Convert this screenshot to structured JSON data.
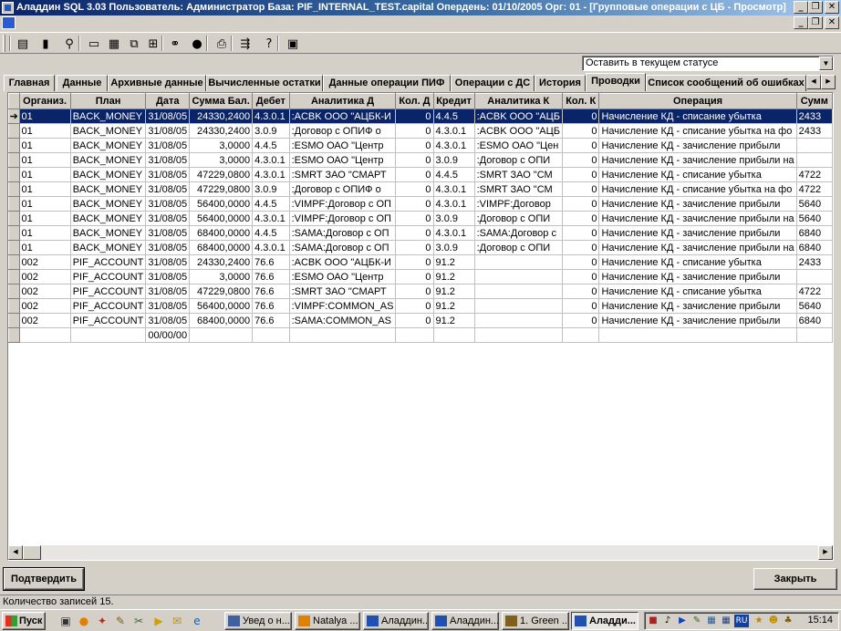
{
  "window": {
    "title": "Аладдин SQL 3.03 Пользователь: Администратор База: PIF_INTERNAL_TEST.capital Опердень: 01/10/2005 Орг: 01 - [Групповые операции с ЦБ - Просмотр]",
    "min_glyph": "_",
    "max_glyph": "❐",
    "close_glyph": "✕"
  },
  "toolbar": {
    "icons": [
      "doc-icon",
      "trash-icon",
      "tree-search-icon",
      "window-icon",
      "grid-icon",
      "cascade-icon",
      "split-icon",
      "binoculars-icon",
      "stop-icon",
      "print-icon",
      "export-icon",
      "help-icon",
      "exit-icon"
    ],
    "glyphs": [
      "▤",
      "▮",
      "⚲",
      "▭",
      "▦",
      "⧉",
      "⊞",
      "⚭",
      "●",
      "⎙",
      "⇶",
      "?",
      "▣"
    ]
  },
  "status_select": {
    "value": "Оставить в текущем статусе"
  },
  "tabs": [
    {
      "label": "Главная",
      "active": false
    },
    {
      "label": "Данные",
      "active": false
    },
    {
      "label": "Архивные данные",
      "active": false
    },
    {
      "label": "Вычисленные остатки",
      "active": false
    },
    {
      "label": "Данные операции ПИФ",
      "active": false
    },
    {
      "label": "Операции с ДС",
      "active": false
    },
    {
      "label": "История",
      "active": false
    },
    {
      "label": "Проводки",
      "active": true
    },
    {
      "label": "Список сообщений об ошибках",
      "active": false
    }
  ],
  "grid": {
    "columns": [
      "Организ.",
      "План",
      "Дата",
      "Сумма Бал.",
      "Дебет",
      "Аналитика Д",
      "Кол. Д",
      "Кредит",
      "Аналитика К",
      "Кол. К",
      "Операция",
      "Сумм"
    ],
    "rows": [
      [
        "01",
        "BACK_MONEY",
        "31/08/05",
        "24330,2400",
        "4.3.0.1",
        ":ACBK ООО \"АЦБК-И",
        "0",
        "4.4.5",
        ":ACBK ООО \"АЦБ",
        "0",
        "Начисление КД - списание убытка",
        "2433"
      ],
      [
        "01",
        "BACK_MONEY",
        "31/08/05",
        "24330,2400",
        "3.0.9",
        ":Договор с ОПИФ о",
        "0",
        "4.3.0.1",
        ":ACBK ООО \"АЦБ",
        "0",
        "Начисление КД - списание убытка на фо",
        "2433"
      ],
      [
        "01",
        "BACK_MONEY",
        "31/08/05",
        "3,0000",
        "4.4.5",
        ":ESMO ОАО \"Центр",
        "0",
        "4.3.0.1",
        ":ESMO ОАО \"Цен",
        "0",
        "Начисление КД - зачисление прибыли",
        ""
      ],
      [
        "01",
        "BACK_MONEY",
        "31/08/05",
        "3,0000",
        "4.3.0.1",
        ":ESMO ОАО \"Центр",
        "0",
        "3.0.9",
        ":Договор с ОПИ",
        "0",
        "Начисление КД - зачисление прибыли на",
        ""
      ],
      [
        "01",
        "BACK_MONEY",
        "31/08/05",
        "47229,0800",
        "4.3.0.1",
        ":SMRT ЗАО \"СМАРТ",
        "0",
        "4.4.5",
        ":SMRT ЗАО \"СМ",
        "0",
        "Начисление КД - списание убытка",
        "4722"
      ],
      [
        "01",
        "BACK_MONEY",
        "31/08/05",
        "47229,0800",
        "3.0.9",
        ":Договор с ОПИФ о",
        "0",
        "4.3.0.1",
        ":SMRT ЗАО \"СМ",
        "0",
        "Начисление КД - списание убытка на фо",
        "4722"
      ],
      [
        "01",
        "BACK_MONEY",
        "31/08/05",
        "56400,0000",
        "4.4.5",
        ":VIMPF:Договор с ОП",
        "0",
        "4.3.0.1",
        ":VIMPF:Договор",
        "0",
        "Начисление КД - зачисление прибыли",
        "5640"
      ],
      [
        "01",
        "BACK_MONEY",
        "31/08/05",
        "56400,0000",
        "4.3.0.1",
        ":VIMPF:Договор с ОП",
        "0",
        "3.0.9",
        ":Договор с ОПИ",
        "0",
        "Начисление КД - зачисление прибыли на",
        "5640"
      ],
      [
        "01",
        "BACK_MONEY",
        "31/08/05",
        "68400,0000",
        "4.4.5",
        ":SAMA:Договор с ОП",
        "0",
        "4.3.0.1",
        ":SAMA:Договор с",
        "0",
        "Начисление КД - зачисление прибыли",
        "6840"
      ],
      [
        "01",
        "BACK_MONEY",
        "31/08/05",
        "68400,0000",
        "4.3.0.1",
        ":SAMA:Договор с ОП",
        "0",
        "3.0.9",
        ":Договор с ОПИ",
        "0",
        "Начисление КД - зачисление прибыли на",
        "6840"
      ],
      [
        "002",
        "PIF_ACCOUNT",
        "31/08/05",
        "24330,2400",
        "76.6",
        ":ACBK ООО \"АЦБК-И",
        "0",
        "91.2",
        "",
        "0",
        "Начисление КД - списание убытка",
        "2433"
      ],
      [
        "002",
        "PIF_ACCOUNT",
        "31/08/05",
        "3,0000",
        "76.6",
        ":ESMO ОАО \"Центр",
        "0",
        "91.2",
        "",
        "0",
        "Начисление КД - зачисление прибыли",
        ""
      ],
      [
        "002",
        "PIF_ACCOUNT",
        "31/08/05",
        "47229,0800",
        "76.6",
        ":SMRT ЗАО \"СМАРТ",
        "0",
        "91.2",
        "",
        "0",
        "Начисление КД - списание убытка",
        "4722"
      ],
      [
        "002",
        "PIF_ACCOUNT",
        "31/08/05",
        "56400,0000",
        "76.6",
        ":VIMPF:COMMON_AS",
        "0",
        "91.2",
        "",
        "0",
        "Начисление КД - зачисление прибыли",
        "5640"
      ],
      [
        "002",
        "PIF_ACCOUNT",
        "31/08/05",
        "68400,0000",
        "76.6",
        ":SAMA:COMMON_AS",
        "0",
        "91.2",
        "",
        "0",
        "Начисление КД - зачисление прибыли",
        "6840"
      ],
      [
        "",
        "",
        "00/00/00",
        "",
        "",
        "",
        "",
        "",
        "",
        "",
        "",
        ""
      ]
    ],
    "selected_row": 0,
    "current_row_marker": "➔"
  },
  "buttons": {
    "confirm": "Подтвердить",
    "close": "Закрыть"
  },
  "status_bar": {
    "text": "Количество записей 15."
  },
  "taskbar": {
    "start": "Пуск",
    "tasks": [
      {
        "label": "Увед о н...",
        "active": false
      },
      {
        "label": "Natalya ...",
        "active": false
      },
      {
        "label": "Аладдин...",
        "active": false
      },
      {
        "label": "Аладдин...",
        "active": false
      },
      {
        "label": "1. Green ...",
        "active": false
      },
      {
        "label": "Аладди...",
        "active": true
      }
    ],
    "lang": "RU",
    "clock": "15:14"
  },
  "colors": {
    "title_active": "#0a246a",
    "selection": "#0a246a",
    "face": "#d4d0c8"
  }
}
